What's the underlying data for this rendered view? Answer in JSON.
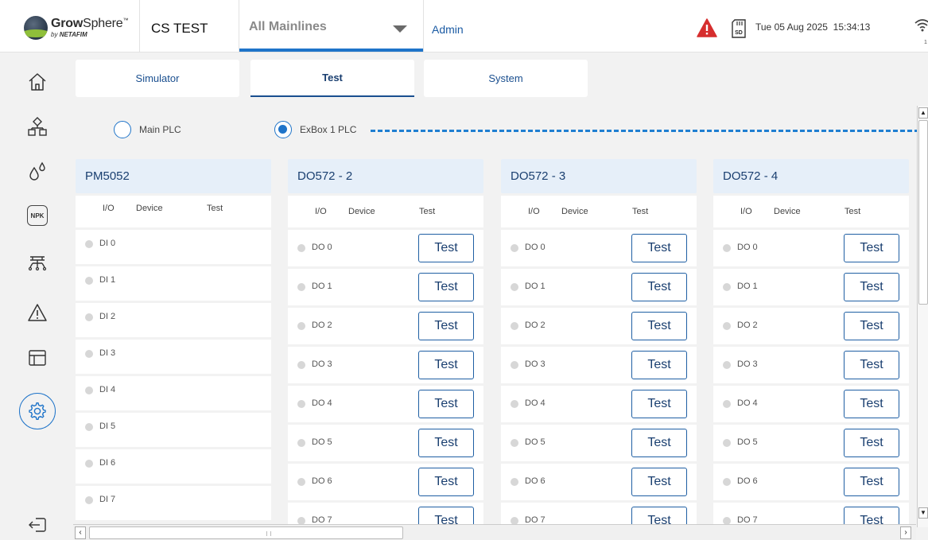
{
  "header": {
    "brand_name_bold": "Grow",
    "brand_name_rest": "Sphere",
    "brand_tm": "™",
    "brand_by": "by",
    "brand_by_company": "NETAFIM",
    "site_name": "CS TEST",
    "mainline_selected": "All Mainlines",
    "user": "Admin",
    "date": "Tue 05 Aug 2025",
    "time": "15:34:13",
    "wifi_strength": "1",
    "sd_label": "SD",
    "colors": {
      "accent": "#1f74c9",
      "alert": "#d62e2e"
    }
  },
  "sidebar": {
    "items": [
      {
        "name": "home",
        "icon": "home-icon"
      },
      {
        "name": "hierarchy",
        "icon": "hierarchy-icon"
      },
      {
        "name": "water",
        "icon": "water-drops-icon"
      },
      {
        "name": "npk",
        "icon": "npk-icon",
        "label": "NPK"
      },
      {
        "name": "irrigation",
        "icon": "irrigation-icon"
      },
      {
        "name": "alarms",
        "icon": "warning-icon"
      },
      {
        "name": "layout",
        "icon": "table-layout-icon"
      },
      {
        "name": "settings",
        "icon": "gear-icon",
        "active": true
      },
      {
        "name": "logout",
        "icon": "logout-icon"
      }
    ]
  },
  "tabs": [
    {
      "label": "Simulator",
      "active": false
    },
    {
      "label": "Test",
      "active": true
    },
    {
      "label": "System",
      "active": false
    }
  ],
  "plc_options": [
    {
      "label": "Main PLC",
      "checked": false
    },
    {
      "label": "ExBox 1 PLC",
      "checked": true
    }
  ],
  "panels": [
    {
      "title": "PM5052",
      "columns": [
        "I/O",
        "Device",
        "Test"
      ],
      "rows": [
        "DI 0",
        "DI 1",
        "DI 2",
        "DI 3",
        "DI 4",
        "DI 5",
        "DI 6",
        "DI 7"
      ],
      "has_test_button": false
    },
    {
      "title": "DO572 - 2",
      "columns": [
        "I/O",
        "Device",
        "Test"
      ],
      "rows": [
        "DO 0",
        "DO 1",
        "DO 2",
        "DO 3",
        "DO 4",
        "DO 5",
        "DO 6",
        "DO 7"
      ],
      "has_test_button": true
    },
    {
      "title": "DO572 - 3",
      "columns": [
        "I/O",
        "Device",
        "Test"
      ],
      "rows": [
        "DO 0",
        "DO 1",
        "DO 2",
        "DO 3",
        "DO 4",
        "DO 5",
        "DO 6",
        "DO 7"
      ],
      "has_test_button": true
    },
    {
      "title": "DO572 - 4",
      "columns": [
        "I/O",
        "Device",
        "Test"
      ],
      "rows": [
        "DO 0",
        "DO 1",
        "DO 2",
        "DO 3",
        "DO 4",
        "DO 5",
        "DO 6",
        "DO 7"
      ],
      "has_test_button": true
    }
  ],
  "test_button_label": "Test"
}
